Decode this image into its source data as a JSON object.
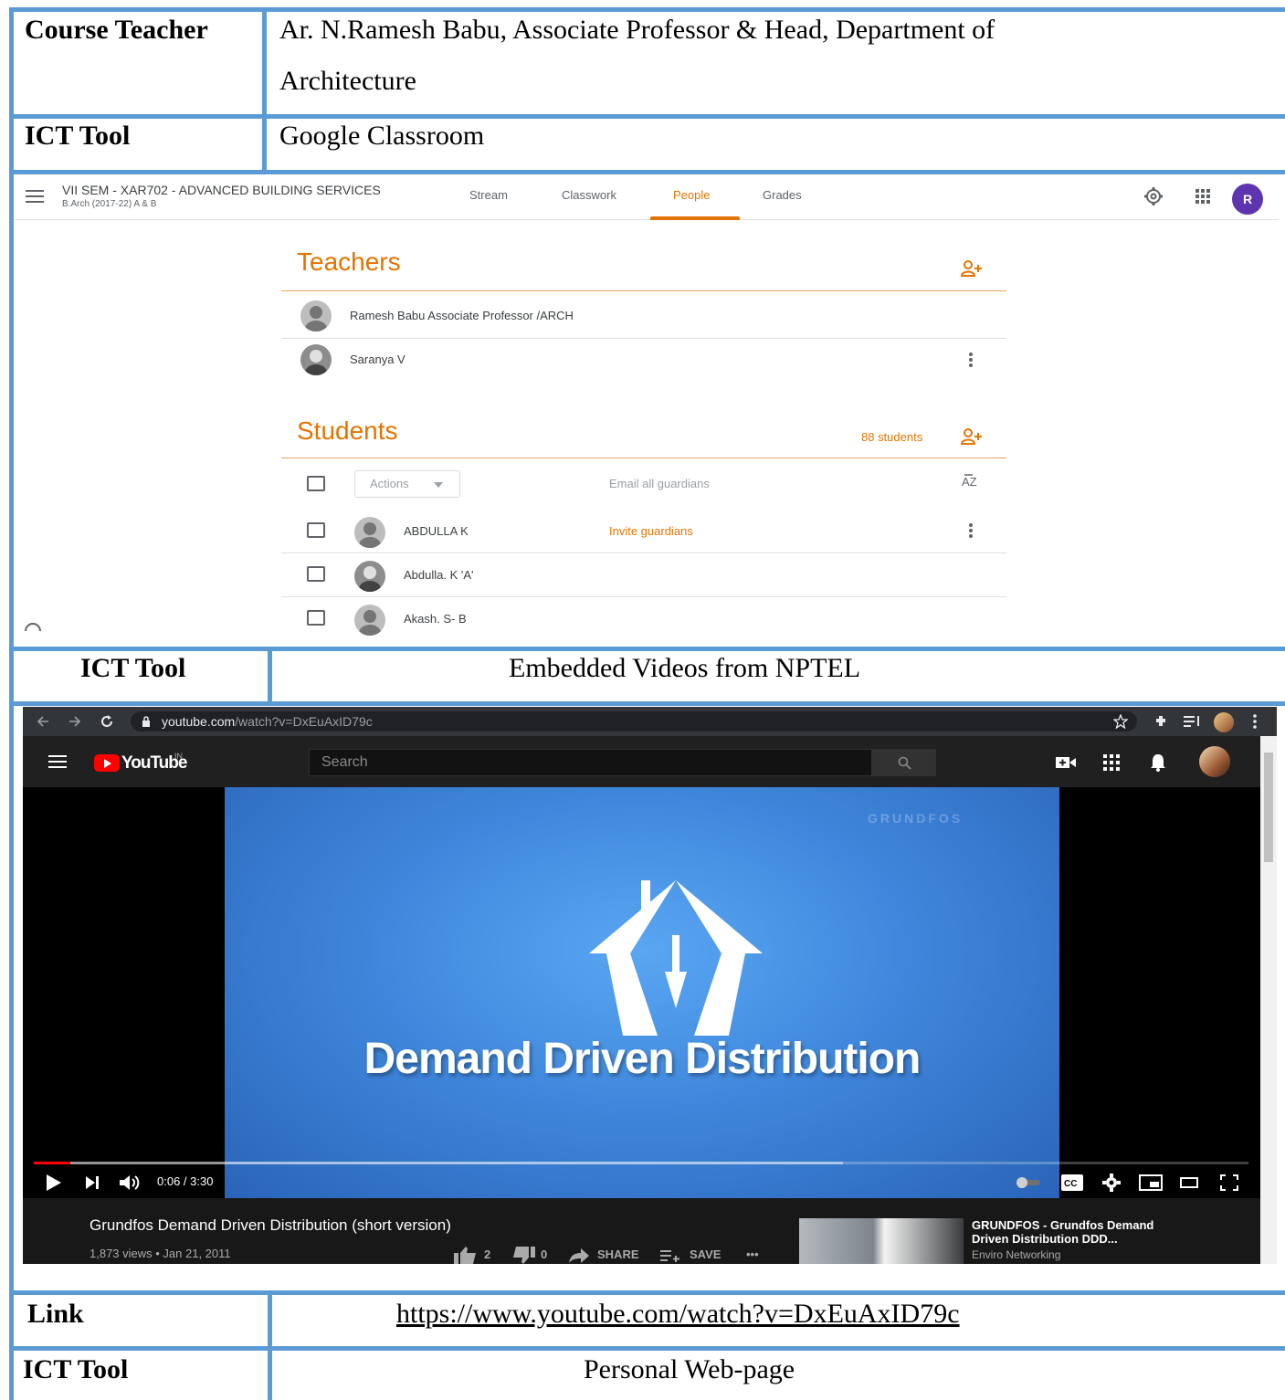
{
  "table": {
    "course_teacher_label": "Course Teacher",
    "course_teacher_line1": "Ar. N.Ramesh Babu, Associate Professor & Head, Department of",
    "course_teacher_line2": "Architecture",
    "ict_tool_label": "ICT Tool",
    "ict_tool_1": "Google Classroom",
    "ict_tool_2": "Embedded Videos from NPTEL",
    "link_label": "Link",
    "link_url": "https://www.youtube.com/watch?v=DxEuAxID79c",
    "ict_tool_3": "Personal Web-page"
  },
  "classroom": {
    "class_title": "VII SEM - XAR702 - ADVANCED BUILDING SERVICES",
    "class_subtitle": "B.Arch (2017-22) A & B",
    "tabs": [
      "Stream",
      "Classwork",
      "People",
      "Grades"
    ],
    "active_tab": "People",
    "avatar_letter": "R",
    "accent_color": "#e37400",
    "teachers_heading": "Teachers",
    "teachers": [
      "Ramesh Babu Associate Professor /ARCH",
      "Saranya V"
    ],
    "students_heading": "Students",
    "students_count": "88 students",
    "actions_label": "Actions",
    "email_guardians": "Email all guardians",
    "invite_guardians": "Invite guardians",
    "students": [
      "ABDULLA K",
      "Abdulla. K 'A'",
      "Akash. S- B"
    ]
  },
  "youtube": {
    "address": "youtube.com",
    "address_path": "/watch?v=DxEuAxID79c",
    "logo_text": "YouTube",
    "logo_region": "IN",
    "search_placeholder": "Search",
    "watermark": "GRUNDFOS",
    "frame_title": "Demand Driven Distribution",
    "time": "0:06 / 3:30",
    "progress_fraction": 0.03,
    "video_title": "Grundfos Demand Driven Distribution (short version)",
    "views_date": "1,873 views • Jan 21, 2011",
    "likes": "2",
    "dislikes": "0",
    "share_label": "SHARE",
    "save_label": "SAVE",
    "more_label": "•••",
    "related_title": "GRUNDFOS - Grundfos Demand Driven Distribution DDD...",
    "related_channel": "Enviro Networking",
    "brand_red": "#ff0000"
  }
}
